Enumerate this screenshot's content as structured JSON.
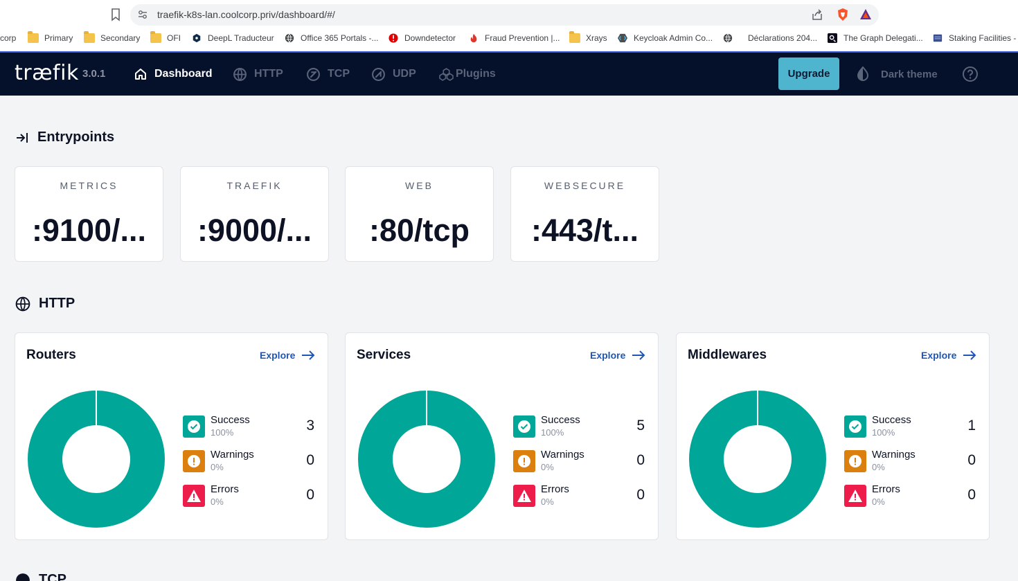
{
  "browser": {
    "url": "traefik-k8s-lan.coolcorp.priv/dashboard/#/",
    "bookmarks": [
      {
        "label": "corp",
        "icon": "none"
      },
      {
        "label": "Primary",
        "icon": "folder-icon"
      },
      {
        "label": "Secondary",
        "icon": "folder-icon"
      },
      {
        "label": "OFI",
        "icon": "folder-icon"
      },
      {
        "label": "DeepL Traducteur",
        "icon": "deepl-icon"
      },
      {
        "label": "Office 365 Portals -...",
        "icon": "globe-icon"
      },
      {
        "label": "Downdetector",
        "icon": "downdetector-icon"
      },
      {
        "label": "Fraud Prevention |...",
        "icon": "flame-icon"
      },
      {
        "label": "Xrays",
        "icon": "folder-icon"
      },
      {
        "label": "Keycloak Admin Co...",
        "icon": "keycloak-icon"
      },
      {
        "label": "",
        "icon": "globe-icon"
      },
      {
        "label": "Déclarations 204...",
        "icon": "none"
      },
      {
        "label": "The Graph Delegati...",
        "icon": "graph-icon"
      },
      {
        "label": "Staking Facilities - c",
        "icon": "stack-icon"
      }
    ]
  },
  "nav": {
    "logo": "træfik",
    "version": "3.0.1",
    "items": [
      {
        "label": "Dashboard",
        "icon": "home-icon",
        "active": true
      },
      {
        "label": "HTTP",
        "icon": "globe-icon",
        "active": false
      },
      {
        "label": "TCP",
        "icon": "tcp-icon",
        "active": false
      },
      {
        "label": "UDP",
        "icon": "udp-icon",
        "active": false
      },
      {
        "label": "Plugins",
        "icon": "plugins-icon",
        "active": false
      }
    ],
    "upgrade_label": "Upgrade",
    "dark_theme_label": "Dark theme"
  },
  "entrypoints": {
    "title": "Entrypoints",
    "items": [
      {
        "name": "METRICS",
        "value": ":9100/..."
      },
      {
        "name": "TRAEFIK",
        "value": ":9000/..."
      },
      {
        "name": "WEB",
        "value": ":80/tcp"
      },
      {
        "name": "WEBSECURE",
        "value": ":443/t..."
      }
    ]
  },
  "http": {
    "title": "HTTP",
    "explore_label": "Explore",
    "cards": [
      {
        "title": "Routers",
        "success": {
          "label": "Success",
          "pct": "100%",
          "count": "3"
        },
        "warnings": {
          "label": "Warnings",
          "pct": "0%",
          "count": "0"
        },
        "errors": {
          "label": "Errors",
          "pct": "0%",
          "count": "0"
        }
      },
      {
        "title": "Services",
        "success": {
          "label": "Success",
          "pct": "100%",
          "count": "5"
        },
        "warnings": {
          "label": "Warnings",
          "pct": "0%",
          "count": "0"
        },
        "errors": {
          "label": "Errors",
          "pct": "0%",
          "count": "0"
        }
      },
      {
        "title": "Middlewares",
        "success": {
          "label": "Success",
          "pct": "100%",
          "count": "1"
        },
        "warnings": {
          "label": "Warnings",
          "pct": "0%",
          "count": "0"
        },
        "errors": {
          "label": "Errors",
          "pct": "0%",
          "count": "0"
        }
      }
    ]
  },
  "tcp": {
    "title": "TCP"
  },
  "colors": {
    "success": "#00a697",
    "warning": "#db7f0e",
    "error": "#ed1c4a",
    "nav_bg": "#05102a",
    "accent": "#4fb5cf"
  }
}
